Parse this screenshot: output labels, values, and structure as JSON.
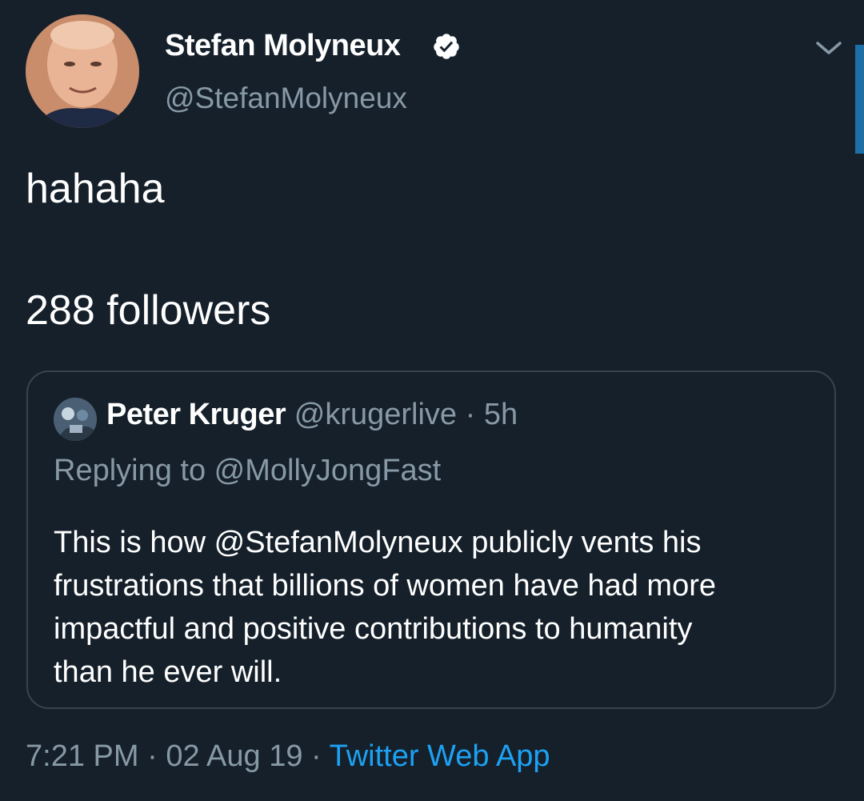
{
  "tweet": {
    "display_name": "Stefan Molyneux",
    "handle": "@StefanMolyneux",
    "verified_icon": "verified-badge-icon",
    "body": [
      "hahaha",
      "288 followers"
    ]
  },
  "quote": {
    "name": "Peter Kruger",
    "handle": "@krugerlive",
    "separator": "·",
    "time": "5h",
    "replying_to": "Replying to @MollyJongFast",
    "text_lines": [
      "This is how @StefanMolyneux publicly vents his",
      "frustrations that billions of women have had more",
      "impactful and positive contributions to humanity",
      "than he ever will."
    ]
  },
  "meta": {
    "time": "7:21 PM",
    "separator": "·",
    "date": "02 Aug 19",
    "source": "Twitter Web App"
  },
  "colors": {
    "background": "#15202b",
    "secondary_text": "#8899a6",
    "link": "#1da1f2",
    "border": "#38444d"
  }
}
